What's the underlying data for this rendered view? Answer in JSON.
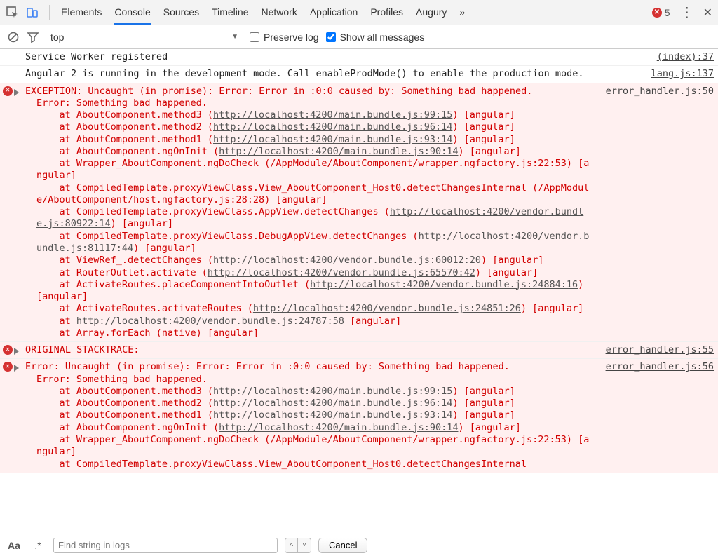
{
  "topbar": {
    "tabs": [
      "Elements",
      "Console",
      "Sources",
      "Timeline",
      "Network",
      "Application",
      "Profiles",
      "Augury"
    ],
    "active_tab": "Console",
    "more": "»",
    "error_count": "5"
  },
  "filter": {
    "context": "top",
    "preserve_label": "Preserve log",
    "preserve_checked": false,
    "showall_label": "Show all messages",
    "showall_checked": true
  },
  "logs": [
    {
      "type": "log",
      "msg": "Service Worker registered",
      "src": "(index):37"
    },
    {
      "type": "log",
      "msg": "Angular 2 is running in the development mode. Call enableProdMode() to enable the production mode.",
      "src": "lang.js:137"
    },
    {
      "type": "err",
      "src": "error_handler.js:50",
      "heading": "EXCEPTION: Uncaught (in promise): Error: Error in :0:0 caused by: Something bad happened.",
      "subheading": "Error: Something bad happened.",
      "stack": [
        {
          "pre": "    at AboutComponent.method3 (",
          "link": "http://localhost:4200/main.bundle.js:99:15",
          "post": ") [angular]"
        },
        {
          "pre": "    at AboutComponent.method2 (",
          "link": "http://localhost:4200/main.bundle.js:96:14",
          "post": ") [angular]"
        },
        {
          "pre": "    at AboutComponent.method1 (",
          "link": "http://localhost:4200/main.bundle.js:93:14",
          "post": ") [angular]"
        },
        {
          "pre": "    at AboutComponent.ngOnInit (",
          "link": "http://localhost:4200/main.bundle.js:90:14",
          "post": ") [angular]"
        },
        {
          "plain": "    at Wrapper_AboutComponent.ngDoCheck (/AppModule/AboutComponent/wrapper.ngfactory.js:22:53) [angular]"
        },
        {
          "plain": "    at CompiledTemplate.proxyViewClass.View_AboutComponent_Host0.detectChangesInternal (/AppModule/AboutComponent/host.ngfactory.js:28:28) [angular]"
        },
        {
          "pre": "    at CompiledTemplate.proxyViewClass.AppView.detectChanges (",
          "link": "http://localhost:4200/vendor.bundle.js:80922:14",
          "post": ") [angular]"
        },
        {
          "pre": "    at CompiledTemplate.proxyViewClass.DebugAppView.detectChanges (",
          "link": "http://localhost:4200/vendor.bundle.js:81117:44",
          "post": ") [angular]"
        },
        {
          "pre": "    at ViewRef_.detectChanges (",
          "link": "http://localhost:4200/vendor.bundle.js:60012:20",
          "post": ") [angular]"
        },
        {
          "pre": "    at RouterOutlet.activate (",
          "link": "http://localhost:4200/vendor.bundle.js:65570:42",
          "post": ") [angular]"
        },
        {
          "pre": "    at ActivateRoutes.placeComponentIntoOutlet (",
          "link": "http://localhost:4200/vendor.bundle.js:24884:16",
          "post": ") [angular]"
        },
        {
          "pre": "    at ActivateRoutes.activateRoutes (",
          "link": "http://localhost:4200/vendor.bundle.js:24851:26",
          "post": ") [angular]"
        },
        {
          "pre": "    at ",
          "link": "http://localhost:4200/vendor.bundle.js:24787:58",
          "post": " [angular]"
        },
        {
          "plain": "    at Array.forEach (native) [angular]"
        }
      ]
    },
    {
      "type": "err",
      "src": "error_handler.js:55",
      "heading": "ORIGINAL STACKTRACE:"
    },
    {
      "type": "err",
      "src": "error_handler.js:56",
      "heading": "Error: Uncaught (in promise): Error: Error in :0:0 caused by: Something bad happened.",
      "subheading": "Error: Something bad happened.",
      "stack": [
        {
          "pre": "    at AboutComponent.method3 (",
          "link": "http://localhost:4200/main.bundle.js:99:15",
          "post": ") [angular]"
        },
        {
          "pre": "    at AboutComponent.method2 (",
          "link": "http://localhost:4200/main.bundle.js:96:14",
          "post": ") [angular]"
        },
        {
          "pre": "    at AboutComponent.method1 (",
          "link": "http://localhost:4200/main.bundle.js:93:14",
          "post": ") [angular]"
        },
        {
          "pre": "    at AboutComponent.ngOnInit (",
          "link": "http://localhost:4200/main.bundle.js:90:14",
          "post": ") [angular]"
        },
        {
          "plain": "    at Wrapper_AboutComponent.ngDoCheck (/AppModule/AboutComponent/wrapper.ngfactory.js:22:53) [angular]"
        },
        {
          "plain": "    at CompiledTemplate.proxyViewClass.View_AboutComponent_Host0.detectChangesInternal"
        }
      ]
    }
  ],
  "find": {
    "placeholder": "Find string in logs",
    "cancel": "Cancel",
    "mode_case": "Aa",
    "mode_regex": ".*"
  }
}
